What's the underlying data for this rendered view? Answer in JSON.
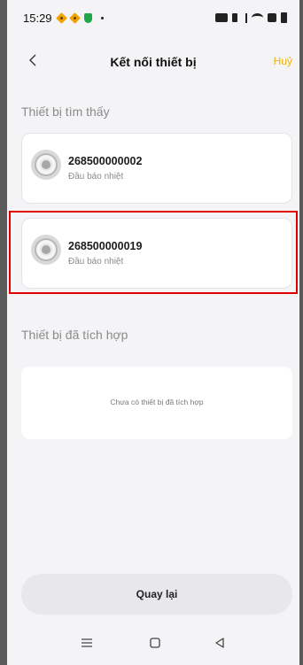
{
  "status_bar": {
    "time": "15:29"
  },
  "header": {
    "title": "Kết nối thiết bị",
    "cancel_label": "Huỷ"
  },
  "found_section": {
    "title": "Thiết bị tìm thấy",
    "devices": [
      {
        "id": "268500000002",
        "type": "Đầu báo nhiệt"
      },
      {
        "id": "268500000019",
        "type": "Đầu báo nhiệt"
      }
    ]
  },
  "integrated_section": {
    "title": "Thiết bị đã tích hợp",
    "empty_text": "Chưa có thiết bị đã tích hợp"
  },
  "bottom_button": {
    "label": "Quay lại"
  },
  "colors": {
    "accent": "#f2b200",
    "highlight": "#e00000",
    "background": "#f4f4f6"
  },
  "icons": {
    "back": "chevron-left-icon",
    "device": "heat-detector-icon",
    "nav_menu": "menu-icon",
    "nav_home": "home-square-icon",
    "nav_back": "triangle-back-icon"
  }
}
